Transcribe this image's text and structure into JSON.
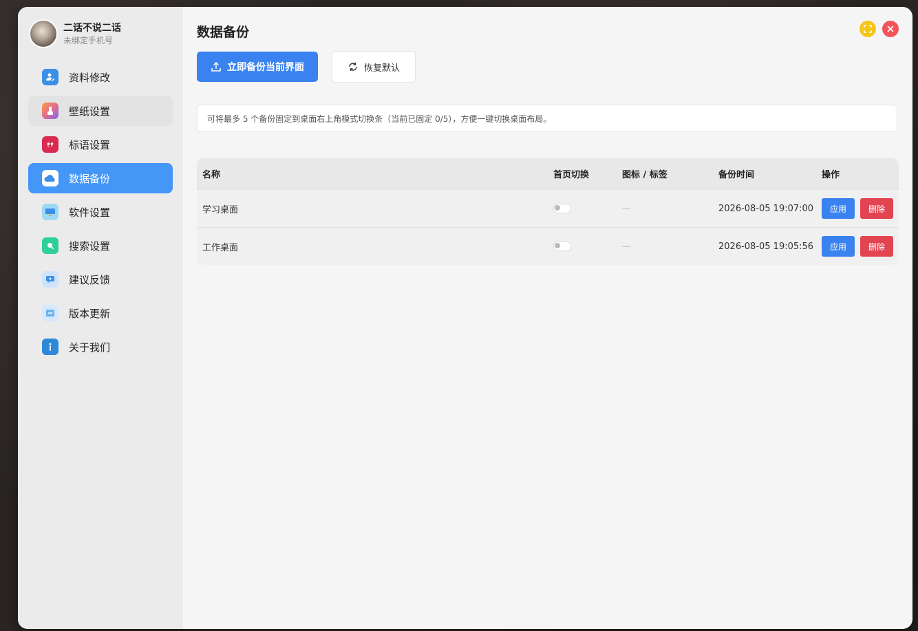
{
  "user": {
    "name": "二话不说二话",
    "subtitle": "未绑定手机号"
  },
  "sidebar": {
    "items": [
      {
        "label": "资料修改",
        "icon": "user-edit-icon",
        "color": "#3b8fe6"
      },
      {
        "label": "壁纸设置",
        "icon": "wallpaper-icon",
        "color": "#e66b8c"
      },
      {
        "label": "标语设置",
        "icon": "quote-icon",
        "color": "#d92b4f"
      },
      {
        "label": "数据备份",
        "icon": "cloud-icon",
        "color": "#4496f7"
      },
      {
        "label": "软件设置",
        "icon": "monitor-icon",
        "color": "#4cb8e8"
      },
      {
        "label": "搜索设置",
        "icon": "search-icon",
        "color": "#2fcf9a"
      },
      {
        "label": "建议反馈",
        "icon": "feedback-icon",
        "color": "#5aa7ef"
      },
      {
        "label": "版本更新",
        "icon": "update-icon",
        "color": "#6ab2ef"
      },
      {
        "label": "关于我们",
        "icon": "info-icon",
        "color": "#2d89d8"
      }
    ],
    "active_index": 3
  },
  "main": {
    "title": "数据备份",
    "backup_button": "立即备份当前界面",
    "restore_button": "恢复默认",
    "notice": "可将最多 5 个备份固定到桌面右上角模式切换条（当前已固定 0/5），方便一键切换桌面布局。"
  },
  "table": {
    "headers": [
      "名称",
      "首页切换",
      "图标 / 标签",
      "备份时间",
      "操作"
    ],
    "rows": [
      {
        "name": "学习桌面",
        "home_switch": false,
        "tags": "—",
        "time": "2026-08-05 19:07:00",
        "apply": "应用",
        "delete": "删除"
      },
      {
        "name": "工作桌面",
        "home_switch": false,
        "tags": "—",
        "time": "2026-08-05 19:05:56",
        "apply": "应用",
        "delete": "删除"
      }
    ]
  },
  "colors": {
    "accent": "#3a82f0",
    "danger": "#e24452",
    "sidebar_active": "#4496f7"
  }
}
